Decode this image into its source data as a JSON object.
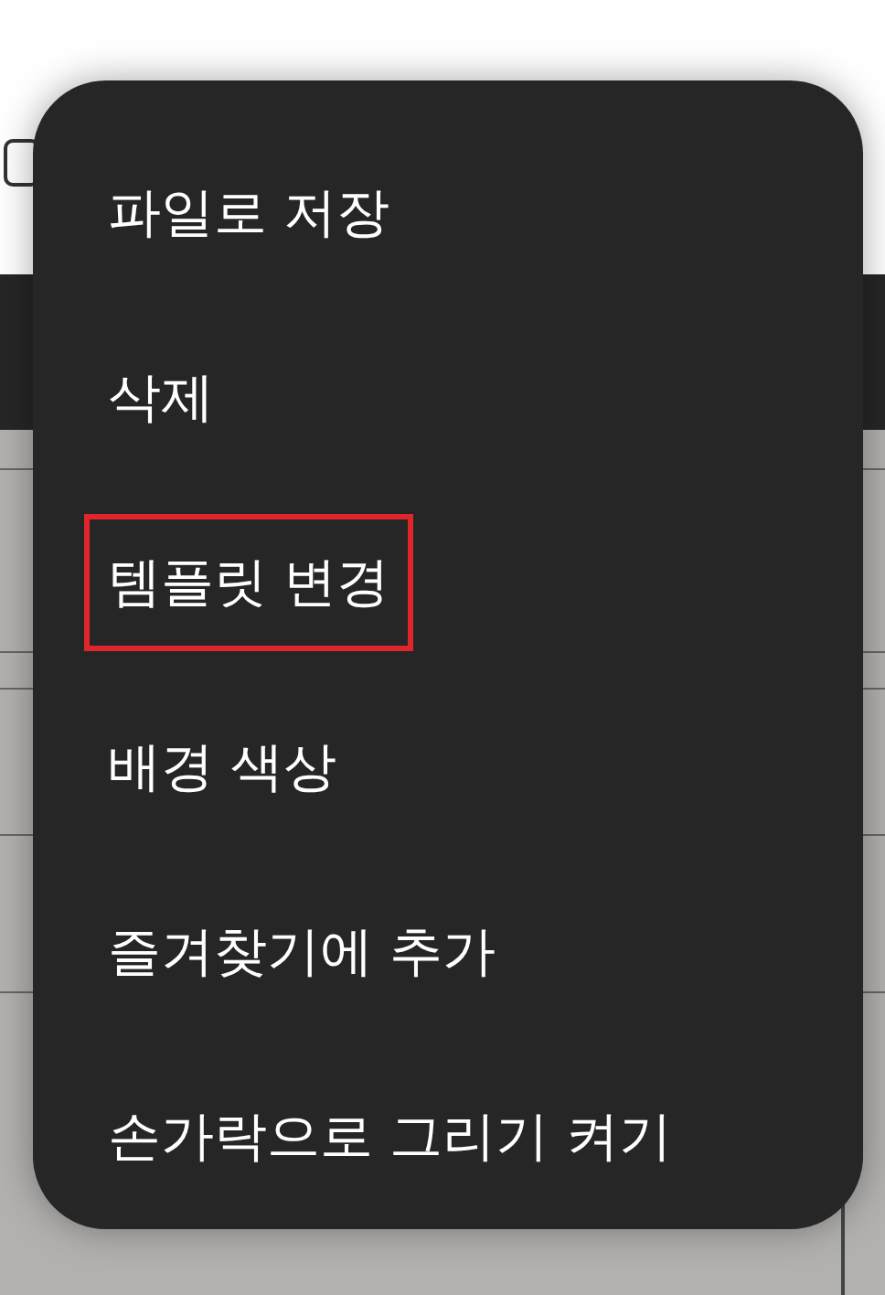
{
  "menu": {
    "items": [
      {
        "label": "파일로 저장",
        "highlighted": false
      },
      {
        "label": "삭제",
        "highlighted": false
      },
      {
        "label": "템플릿 변경",
        "highlighted": true
      },
      {
        "label": "배경 색상",
        "highlighted": false
      },
      {
        "label": "즐겨찾기에 추가",
        "highlighted": false
      },
      {
        "label": "손가락으로 그리기 켜기",
        "highlighted": false
      }
    ]
  }
}
